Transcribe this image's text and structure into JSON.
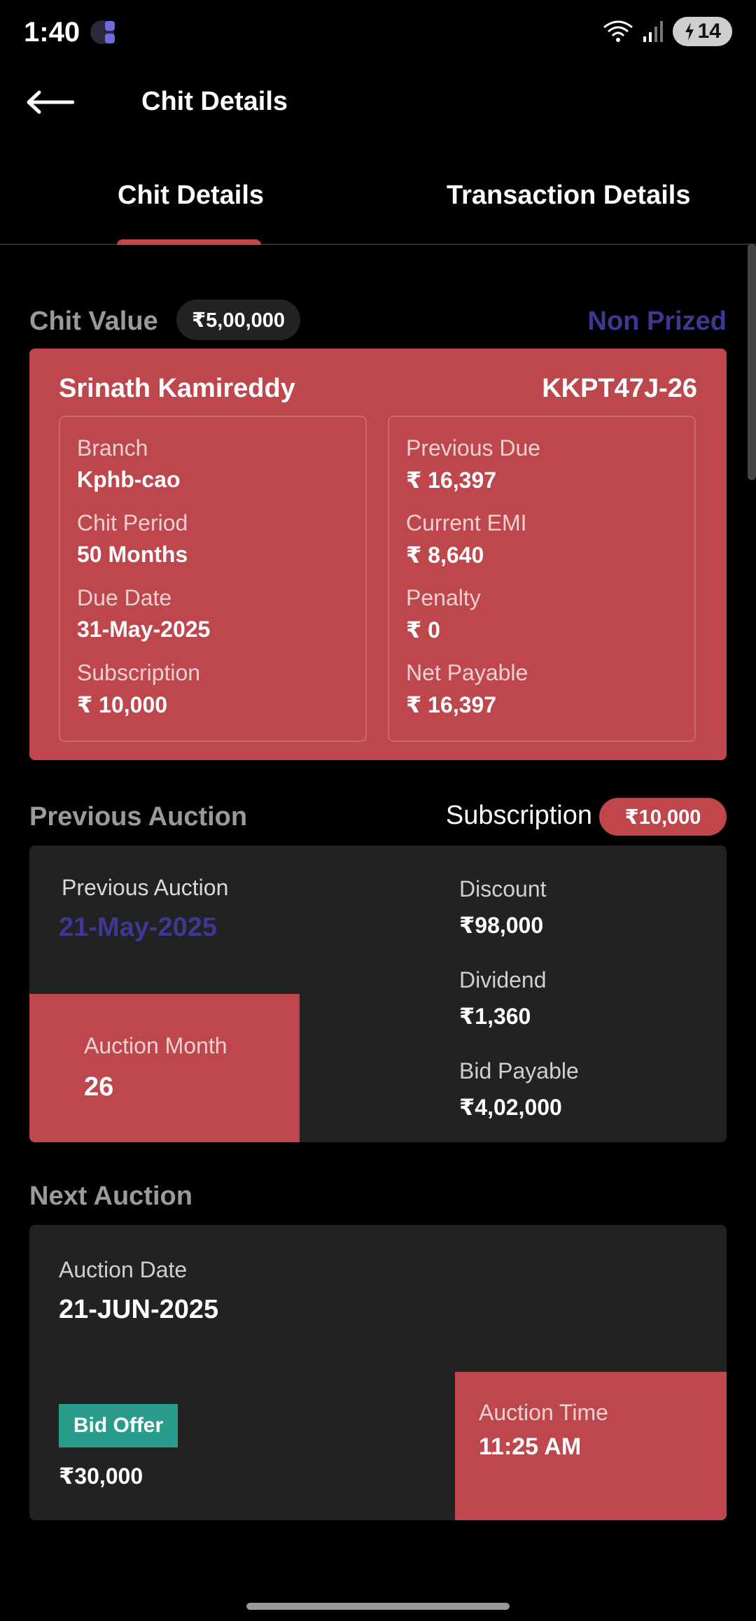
{
  "status_bar": {
    "time": "1:40",
    "battery": "14"
  },
  "app_bar": {
    "title": "Chit Details"
  },
  "tabs": [
    {
      "label": "Chit Details",
      "active": true
    },
    {
      "label": "Transaction Details",
      "active": false
    }
  ],
  "chit": {
    "value_label": "Chit Value",
    "value": "₹5,00,000",
    "status": "Non Prized",
    "holder": "Srinath Kamireddy",
    "id": "KKPT47J-26",
    "left": [
      {
        "label": "Branch",
        "value": "Kphb-cao"
      },
      {
        "label": "Chit Period",
        "value": "50 Months"
      },
      {
        "label": "Due Date",
        "value": "31-May-2025"
      },
      {
        "label": "Subscription",
        "value": "₹ 10,000"
      }
    ],
    "right": [
      {
        "label": "Previous Due",
        "value": "₹ 16,397"
      },
      {
        "label": "Current EMI",
        "value": "₹ 8,640"
      },
      {
        "label": "Penalty",
        "value": "₹ 0"
      },
      {
        "label": "Net Payable",
        "value": "₹ 16,397"
      }
    ]
  },
  "previous_auction": {
    "title": "Previous Auction",
    "subscription_label": "Subscription",
    "subscription_value": "₹10,000",
    "date_label": "Previous Auction",
    "date": "21-May-2025",
    "month_label": "Auction Month",
    "month": "26",
    "details": [
      {
        "label": "Discount",
        "value": "₹98,000"
      },
      {
        "label": "Dividend",
        "value": "₹1,360"
      },
      {
        "label": "Bid Payable",
        "value": "₹4,02,000"
      }
    ]
  },
  "next_auction": {
    "title": "Next Auction",
    "date_label": "Auction Date",
    "date": "21-JUN-2025",
    "bid_offer_label": "Bid Offer",
    "bid_offer_value": "₹30,000",
    "time_label": "Auction Time",
    "time": "11:25 AM"
  },
  "colors": {
    "accent_red": "#bd474d",
    "prized_purple": "#3d3894",
    "bid_green": "#2a9c8c",
    "card_dark": "#222222"
  }
}
